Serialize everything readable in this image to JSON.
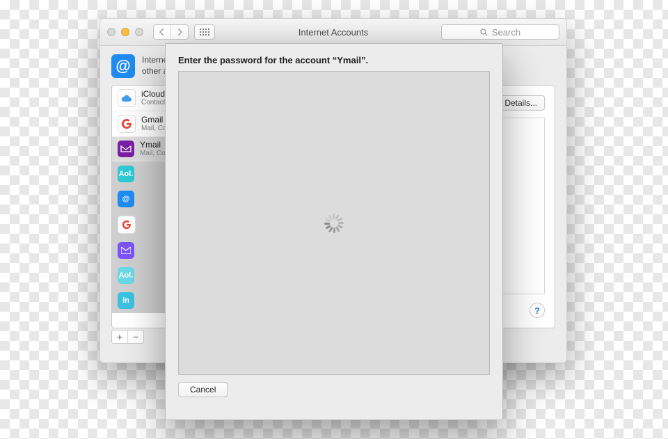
{
  "window": {
    "title": "Internet Accounts",
    "search_placeholder": "Search"
  },
  "header": {
    "text_line1": "Internet Accounts sets up your accounts to use with Mail, Contacts, Calendar, Messages, and",
    "text_line2": "other apps."
  },
  "accounts": [
    {
      "name": "iCloud",
      "sub": "Contacts"
    },
    {
      "name": "Gmail",
      "sub": "Mail, Contacts"
    },
    {
      "name": "Ymail",
      "sub": "Mail, Contacts"
    }
  ],
  "providers_visible": [
    "aol",
    "at",
    "google",
    "message",
    "aol2",
    "linkedin"
  ],
  "details_button": "Details...",
  "add_button": "+",
  "remove_button": "−",
  "help_button": "?",
  "sheet": {
    "title": "Enter the password for the account “Ymail”.",
    "cancel": "Cancel"
  }
}
